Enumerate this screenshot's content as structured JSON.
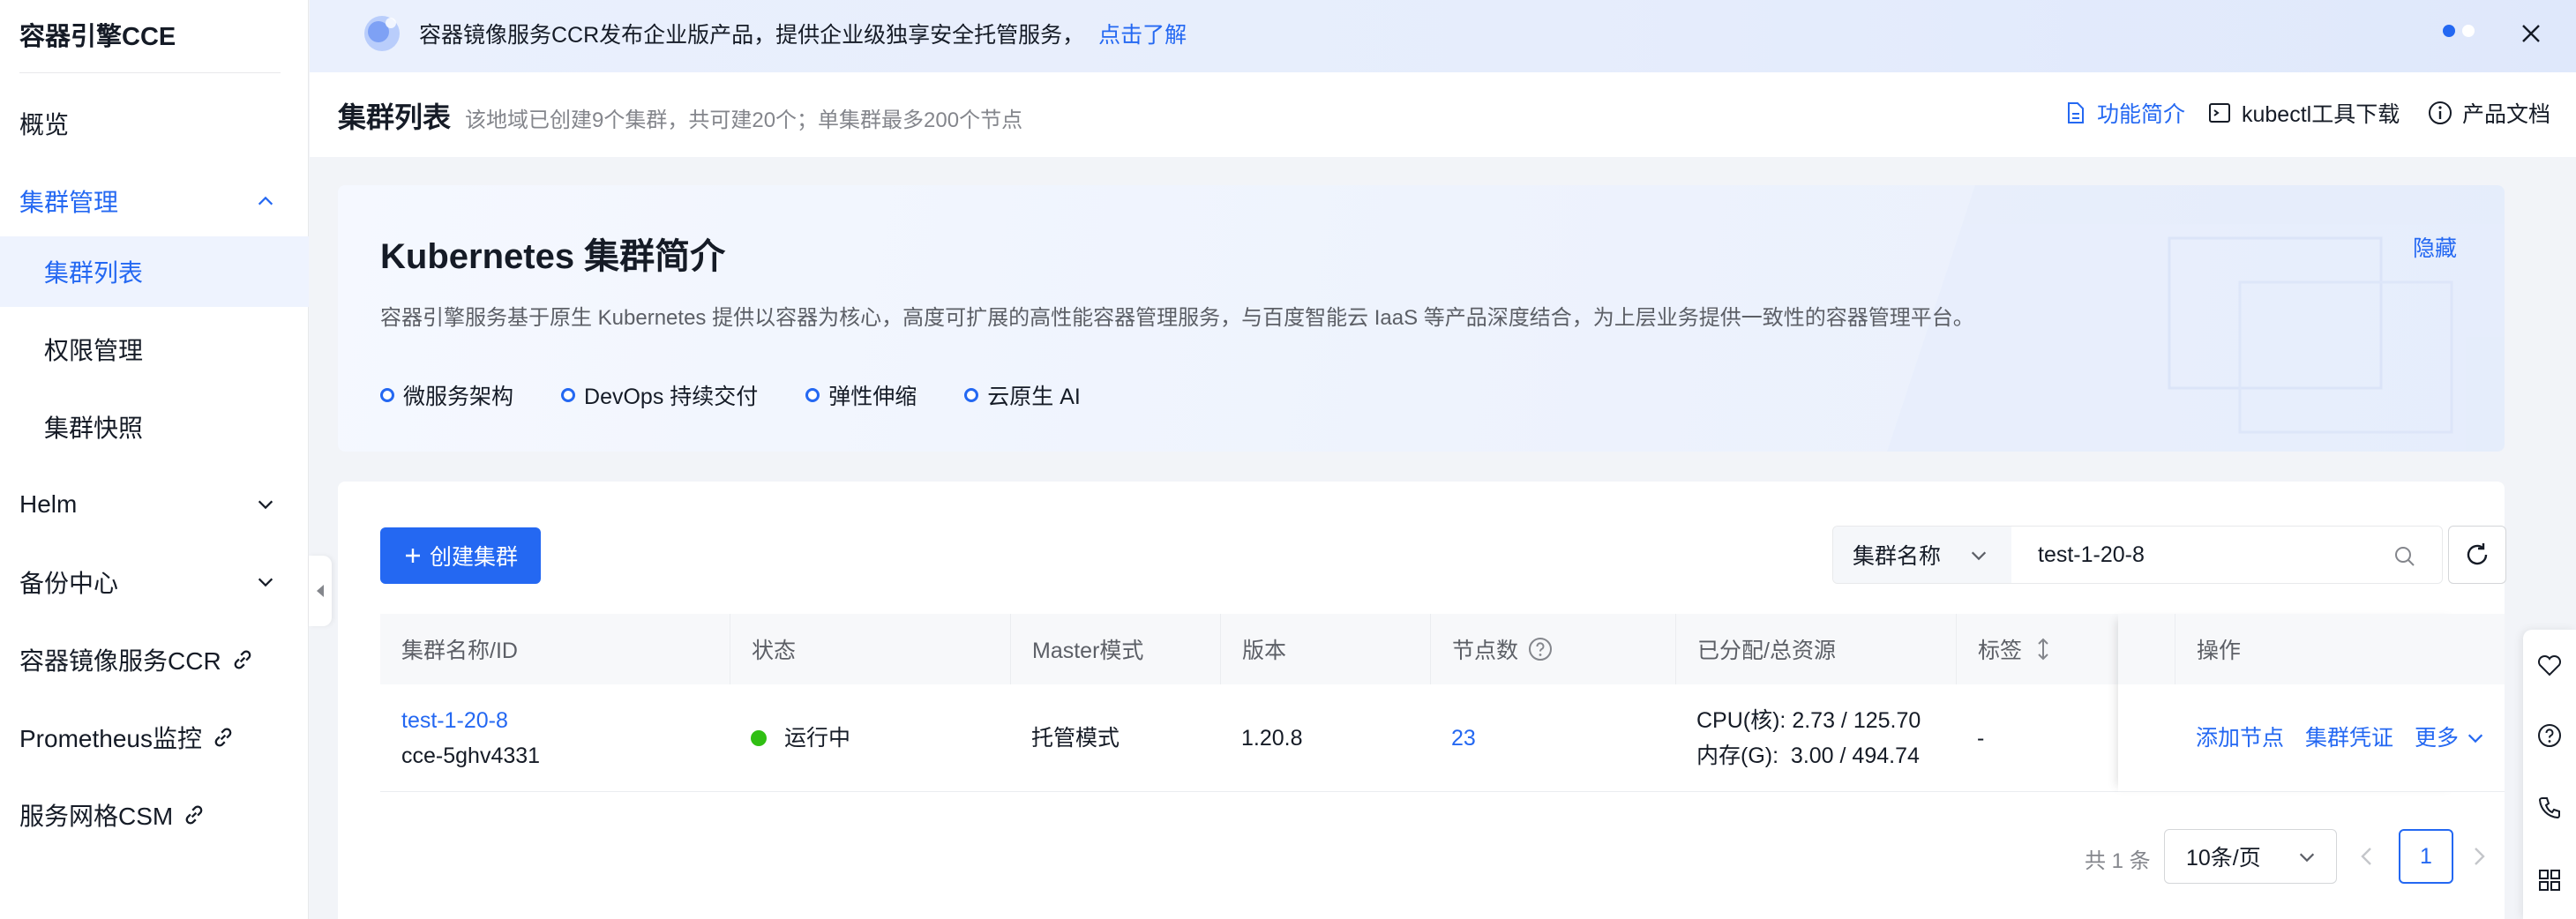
{
  "sidebar": {
    "brand": "容器引擎CCE",
    "items": [
      {
        "label": "概览"
      },
      {
        "label": "集群管理"
      },
      {
        "label": "集群列表"
      },
      {
        "label": "权限管理"
      },
      {
        "label": "集群快照"
      },
      {
        "label": "Helm"
      },
      {
        "label": "备份中心"
      },
      {
        "label": "容器镜像服务CCR"
      },
      {
        "label": "Prometheus监控"
      },
      {
        "label": "服务网格CSM"
      }
    ]
  },
  "banner": {
    "text": "容器镜像服务CCR发布企业版产品，提供企业级独享安全托管服务，",
    "link": "点击了解"
  },
  "header": {
    "title": "集群列表",
    "subtitle": "该地域已创建9个集群，共可建20个；单集群最多200个节点",
    "actions": [
      "功能简介",
      "kubectl工具下载",
      "产品文档"
    ]
  },
  "intro": {
    "title": "Kubernetes 集群简介",
    "hide": "隐藏",
    "description": "容器引擎服务基于原生 Kubernetes 提供以容器为核心，高度可扩展的高性能容器管理服务，与百度智能云 IaaS 等产品深度结合，为上层业务提供一致性的容器管理平台。",
    "tags": [
      "微服务架构",
      "DevOps 持续交付",
      "弹性伸缩",
      "云原生 AI"
    ]
  },
  "toolbar": {
    "create_label": "创建集群",
    "search_field": "集群名称",
    "search_value": "test-1-20-8"
  },
  "table": {
    "columns": [
      "集群名称/ID",
      "状态",
      "Master模式",
      "版本",
      "节点数",
      "已分配/总资源",
      "标签",
      "操作"
    ],
    "rows": [
      {
        "name": "test-1-20-8",
        "id": "cce-5ghv4331",
        "status": "运行中",
        "master_mode": "托管模式",
        "version": "1.20.8",
        "nodes": "23",
        "cpu": "CPU(核): 2.73 / 125.70",
        "mem": "内存(G):  3.00 / 494.74",
        "tags": "-",
        "ops": [
          "添加节点",
          "集群凭证",
          "更多"
        ]
      }
    ]
  },
  "pagination": {
    "total": "共 1 条",
    "page_size": "10条/页",
    "current_page": "1"
  },
  "colors": {
    "accent": "#2468f2",
    "running": "#30bf13"
  }
}
